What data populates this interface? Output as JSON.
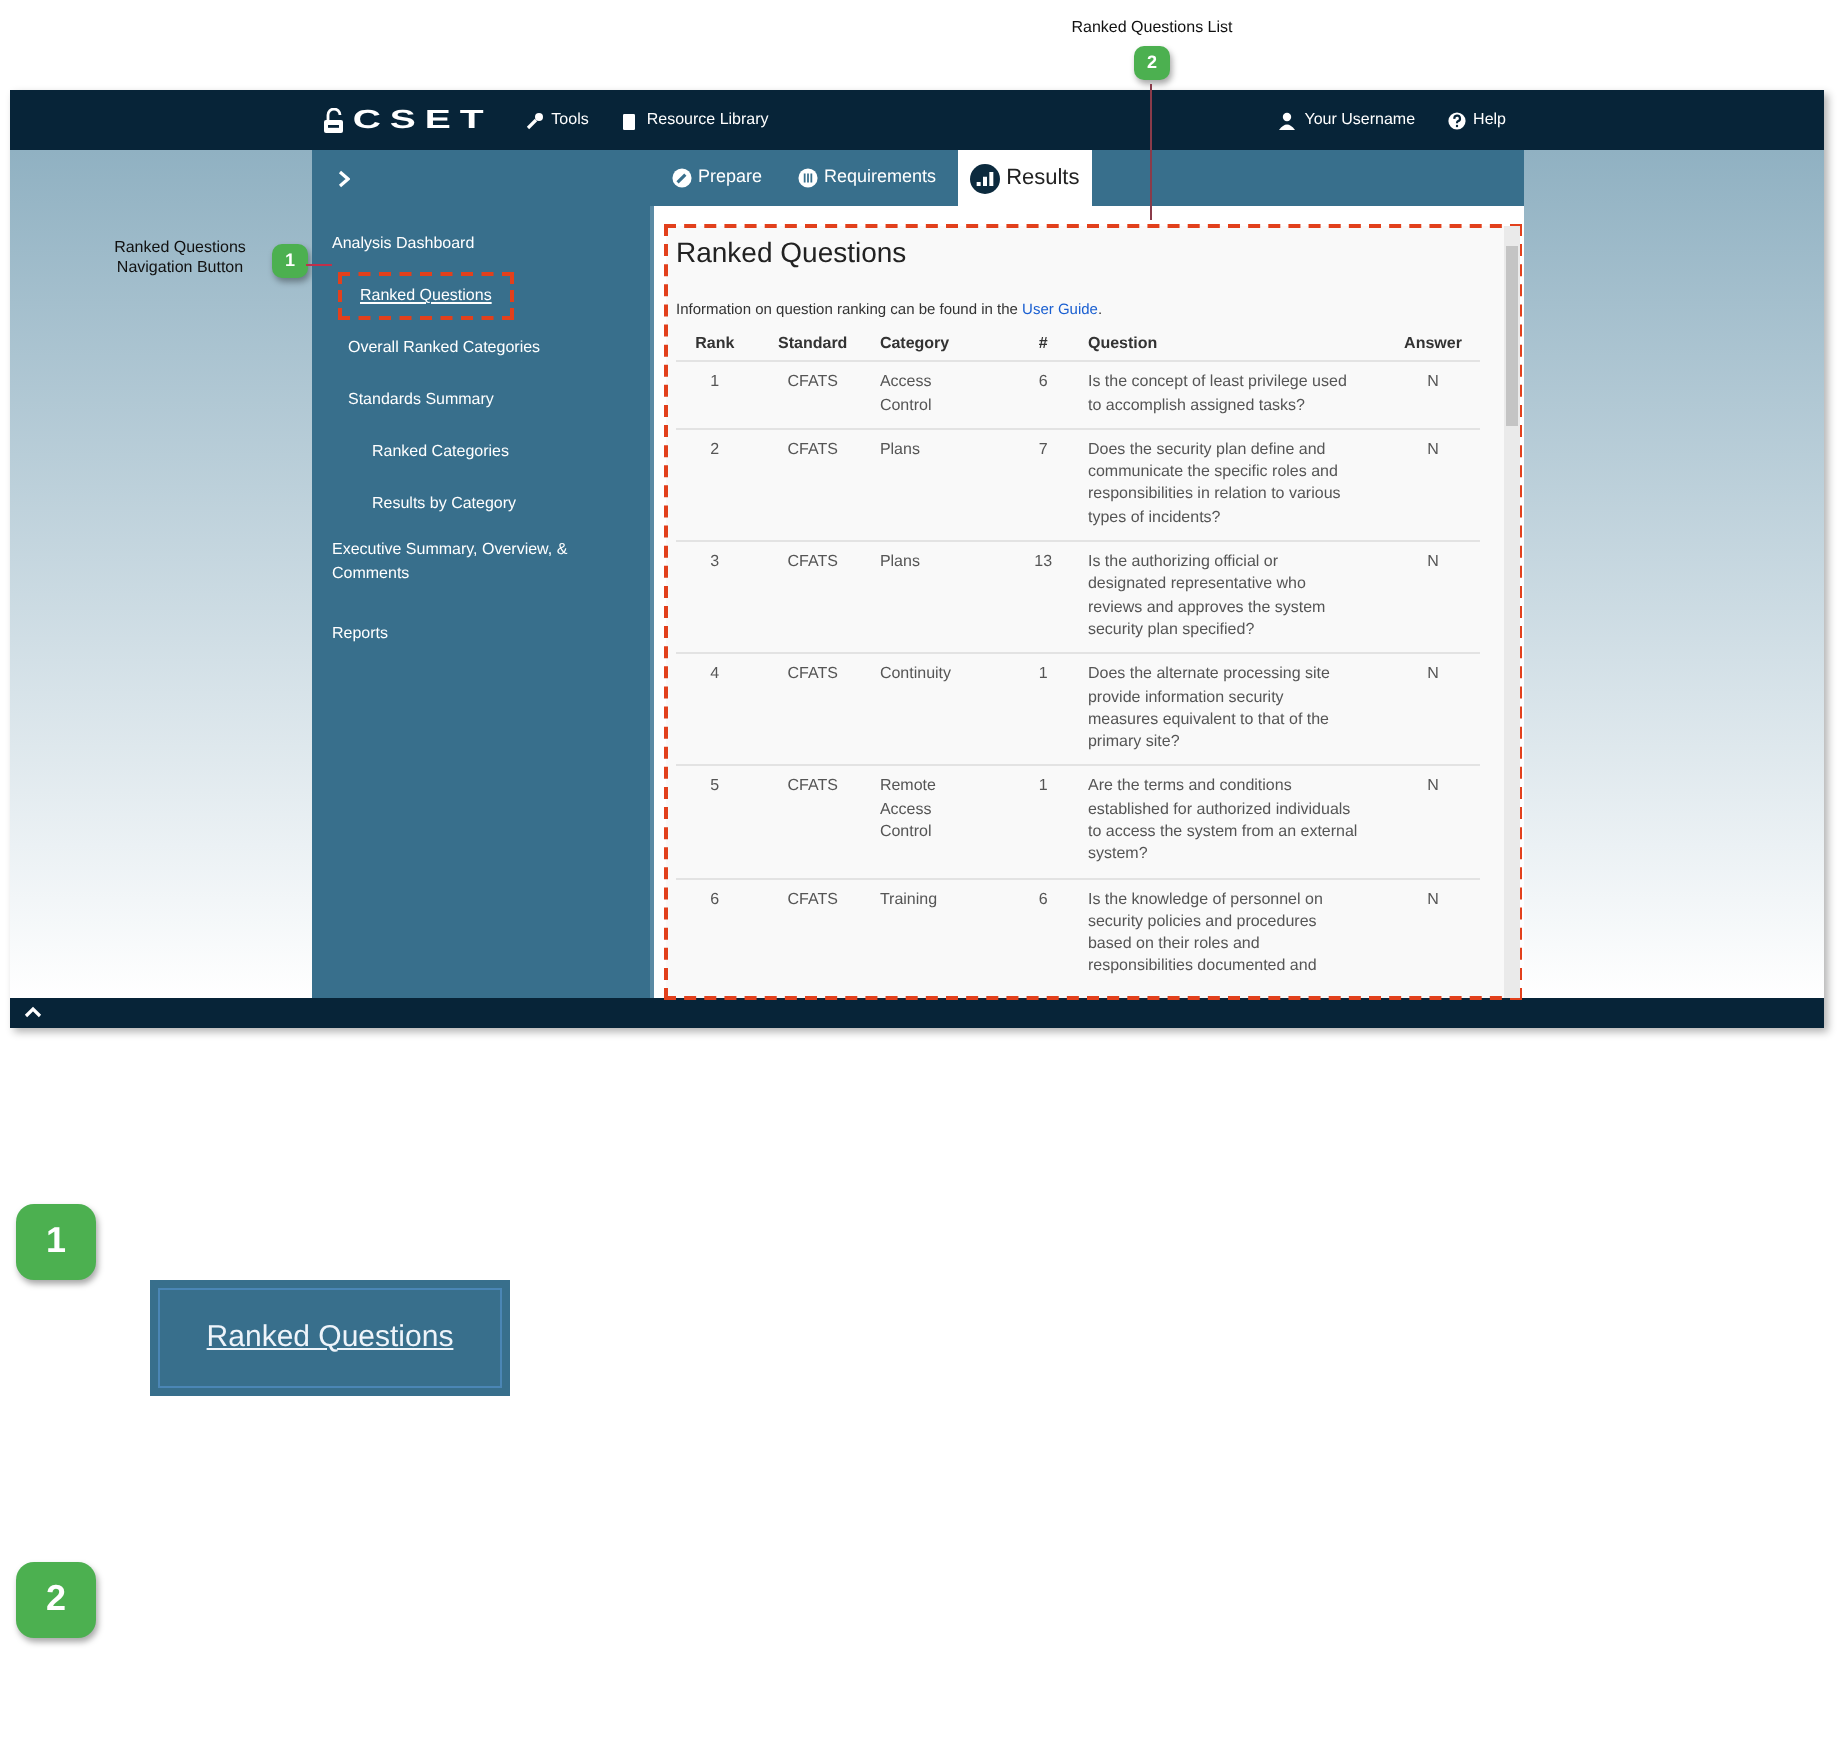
{
  "top_callout": {
    "number": "2",
    "label": "Ranked Questions List"
  },
  "app": {
    "navbar": {
      "brand": "CSET",
      "left_items": [
        {
          "kind": "tools",
          "label": "Tools"
        },
        {
          "kind": "library",
          "label": "Resource Library"
        }
      ],
      "right_items": [
        {
          "kind": "user",
          "label": "Your Username"
        },
        {
          "kind": "help",
          "label": "Help"
        }
      ]
    },
    "side_callout": {
      "number": "1",
      "label": "Ranked Questions Navigation Button"
    },
    "tabs": [
      {
        "kind": "prepare",
        "label": "Prepare",
        "selected": false
      },
      {
        "kind": "requirements",
        "label": "Requirements",
        "selected": false
      },
      {
        "kind": "results",
        "label": "Results",
        "selected": true
      }
    ],
    "sidebar": {
      "items": [
        {
          "label": "Analysis Dashboard",
          "selected": false,
          "highlighted": false,
          "children": [
            {
              "label": "Ranked Questions",
              "selected": true,
              "highlighted": true
            },
            {
              "label": "Overall Ranked Categories",
              "selected": false,
              "highlighted": false
            },
            {
              "label": "Standards Summary",
              "selected": false,
              "highlighted": false,
              "children": [
                {
                  "label": "Ranked Categories",
                  "selected": false,
                  "highlighted": false
                },
                {
                  "label": "Results by Category",
                  "selected": false,
                  "highlighted": false
                }
              ]
            }
          ]
        },
        {
          "label": "Executive Summary, Overview, & Comments",
          "selected": false,
          "highlighted": false
        },
        {
          "label": "Reports",
          "selected": false,
          "highlighted": false
        }
      ]
    },
    "results_panel": {
      "highlighted": true,
      "title": "Ranked Questions",
      "intro": {
        "before": "Information on question ranking can be found in the ",
        "link": "User Guide",
        "after": "."
      },
      "columns": [
        "Rank",
        "Standard",
        "Category",
        "#",
        "Question",
        "Answer"
      ],
      "rows": [
        {
          "rank": "1",
          "standard": "CFATS",
          "category": "Access Control",
          "number": "6",
          "question": "Is the concept of least privilege used to accomplish assigned tasks?",
          "answer": "N"
        },
        {
          "rank": "2",
          "standard": "CFATS",
          "category": "Plans",
          "number": "7",
          "question": "Does the security plan define and communicate the specific roles and responsibilities in relation to various types of incidents?",
          "answer": "N"
        },
        {
          "rank": "3",
          "standard": "CFATS",
          "category": "Plans",
          "number": "13",
          "question": "Is the authorizing official or designated representative who reviews and approves the system security plan specified?",
          "answer": "N"
        },
        {
          "rank": "4",
          "standard": "CFATS",
          "category": "Continuity",
          "number": "1",
          "question": "Does the alternate processing site provide information security measures equivalent to that of the primary site?",
          "answer": "N"
        },
        {
          "rank": "5",
          "standard": "CFATS",
          "category": "Remote Access Control",
          "number": "1",
          "question": "Are the terms and conditions established for authorized individuals to access the system from an external system?",
          "answer": "N"
        },
        {
          "rank": "6",
          "standard": "CFATS",
          "category": "Training",
          "number": "6",
          "question": "Is the knowledge of personnel on security policies and procedures based on their roles and responsibilities documented and",
          "answer": "N"
        }
      ]
    }
  },
  "sections": [
    {
      "number": "1",
      "preview": {
        "label": "Ranked Questions"
      }
    },
    {
      "number": "2"
    }
  ]
}
